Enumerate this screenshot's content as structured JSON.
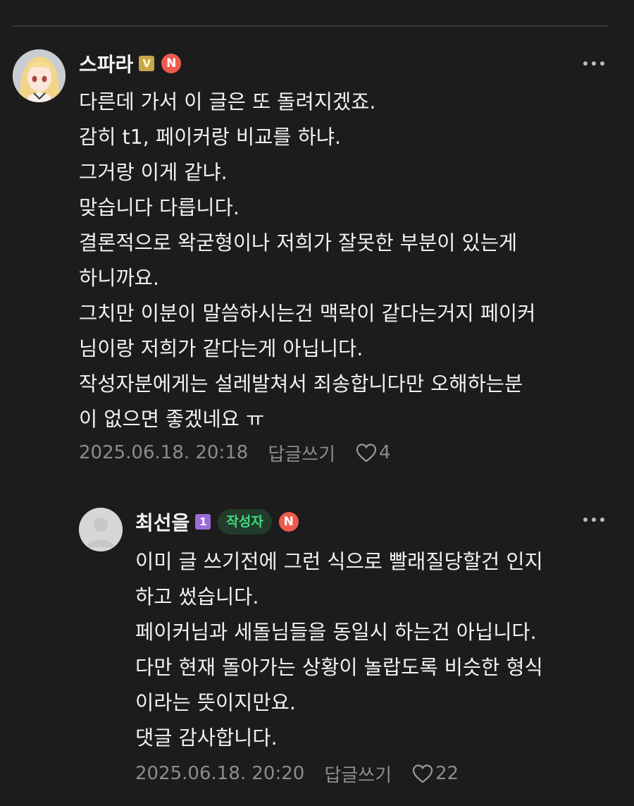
{
  "comments": [
    {
      "author": "스파라",
      "level_badge": "V",
      "new_badge": "N",
      "body": "다른데 가서 이 글은 또 돌려지겠죠.\n감히 t1, 페이커랑 비교를 하냐.\n그거랑 이게 같냐.\n맞습니다 다릅니다.\n결론적으로 왁굳형이나 저희가 잘못한 부분이 있는게\n하니까요.\n그치만 이분이 말씀하시는건 맥락이 같다는거지 페이커\n님이랑 저희가 같다는게 아닙니다.\n작성자분에게는 설레발쳐서 죄송합니다만 오해하는분\n이 없으면 좋겠네요 ㅠ",
      "date": "2025.06.18. 20:18",
      "reply_label": "답글쓰기",
      "likes": "4"
    },
    {
      "author": "최선을",
      "level_badge": "1",
      "writer_tag": "작성자",
      "new_badge": "N",
      "body": "이미 글 쓰기전에 그런 식으로 빨래질당할건 인지\n하고 썼습니다.\n페이커님과 세돌님들을 동일시 하는건 아닙니다.\n다만 현재 돌아가는 상황이 놀랍도록 비슷한 형식\n이라는 뜻이지만요.\n댓글 감사합니다.",
      "date": "2025.06.18. 20:20",
      "reply_label": "답글쓰기",
      "likes": "22"
    }
  ],
  "colors": {
    "background": "#1c1c1c",
    "writer_tag_text": "#3fdb7a",
    "new_badge": "#ef5a4e",
    "meta_text": "#8c8c8c"
  }
}
